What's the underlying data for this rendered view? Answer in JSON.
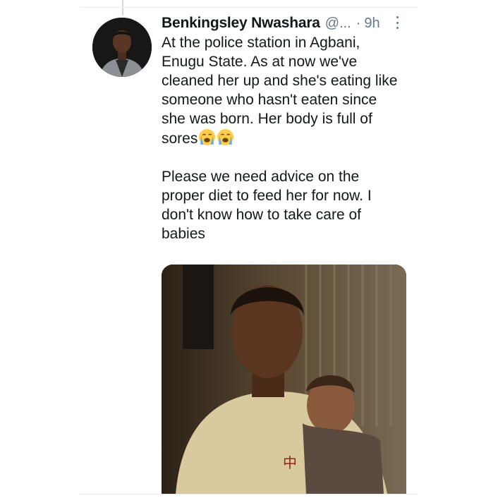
{
  "tweet": {
    "author_name": "Benkingsley Nwashara",
    "handle": "@...",
    "separator": "·",
    "time": "9h",
    "text_lines_para1": [
      "At the police station in Agbani,",
      "Enugu State. As at now we've",
      "cleaned her up and she's eating like",
      "someone who hasn't eaten since",
      "she was born. Her body is full of",
      "sores"
    ],
    "text_lines_para2": [
      "Please we need advice on the",
      "proper diet to feed her for now. I",
      "don't know how to take care of",
      "babies"
    ],
    "emojis": [
      "loudly-crying-face",
      "loudly-crying-face"
    ],
    "media": {
      "alt": "Photo of a young man holding a baby"
    },
    "embedded_text_in_photo": "中"
  },
  "colors": {
    "text": "#14171a",
    "secondary": "#657786",
    "divider": "#e6ecf0",
    "emoji_face": "#ffcc4d",
    "emoji_tears": "#5dadec"
  }
}
